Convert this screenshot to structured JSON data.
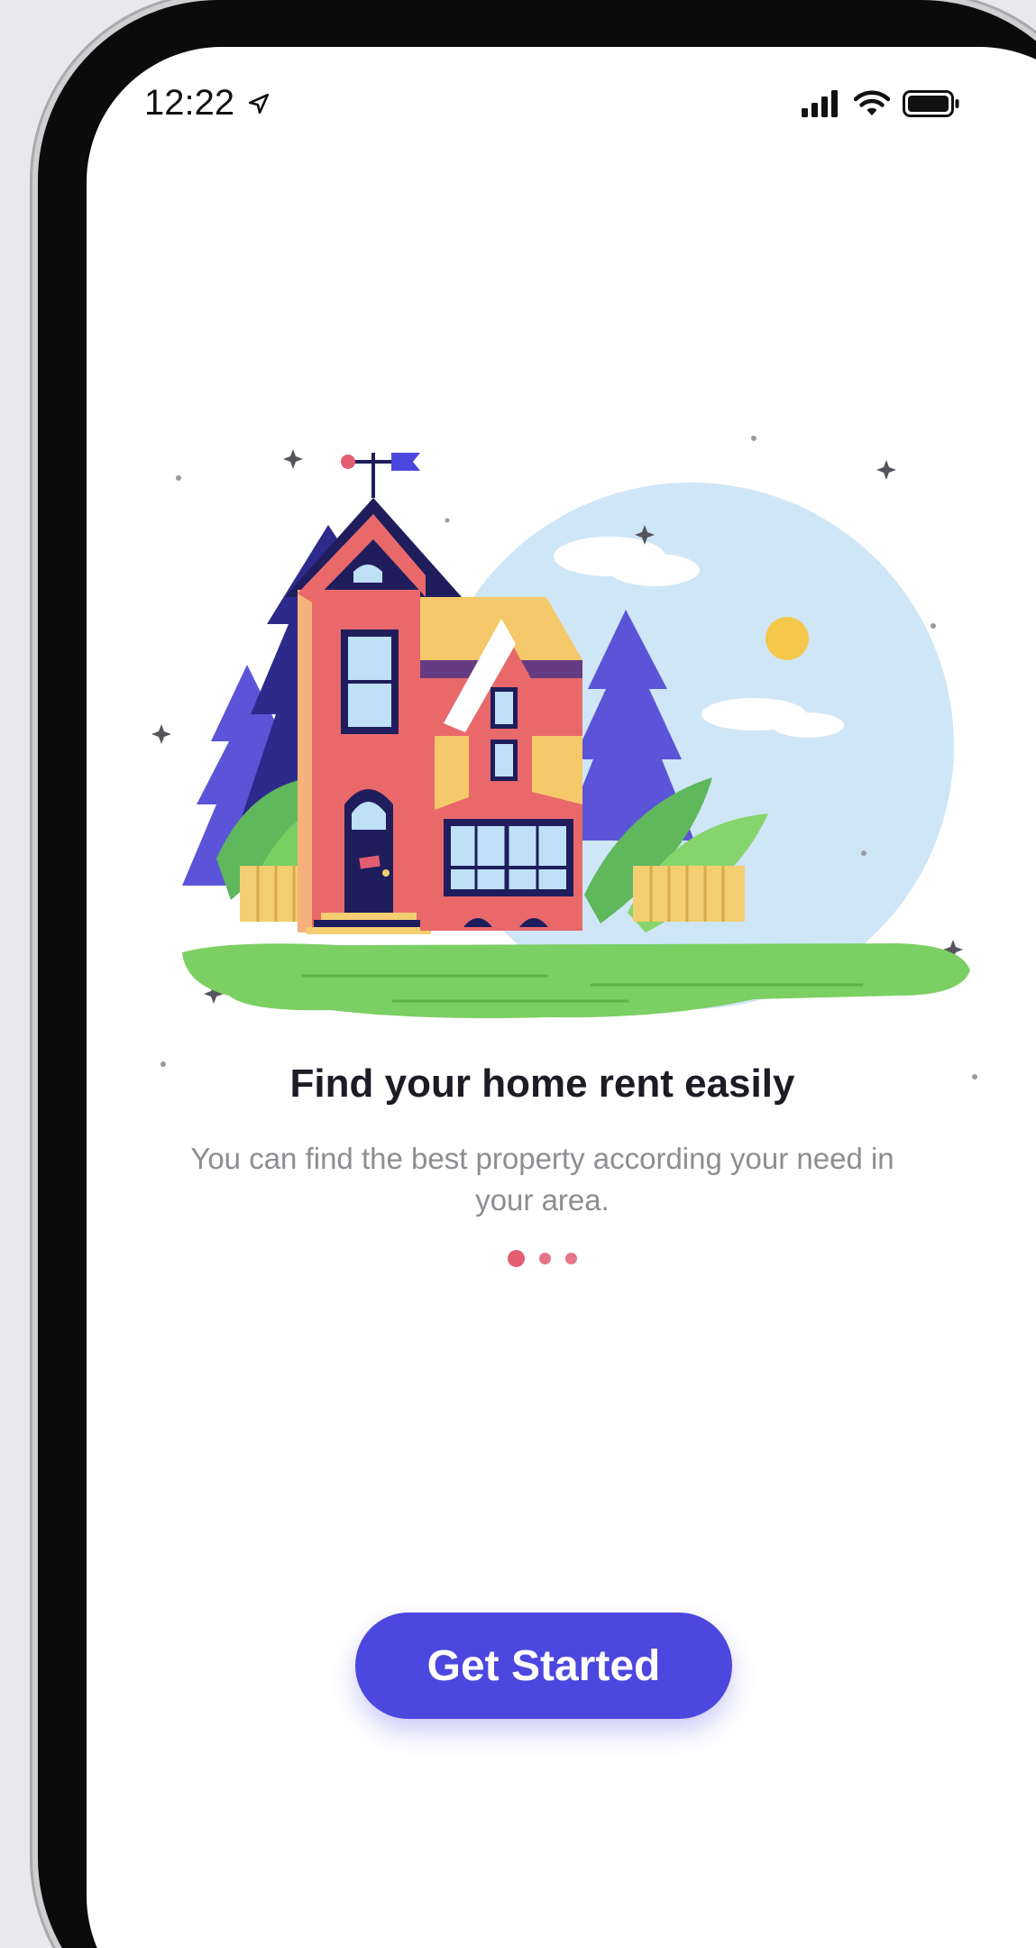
{
  "status_bar": {
    "time": "12:22",
    "location_icon": "location-arrow-icon",
    "signal_icon": "cellular-signal-icon",
    "wifi_icon": "wifi-icon",
    "battery_icon": "battery-icon"
  },
  "onboarding": {
    "illustration": "house-illustration",
    "title": "Find your home rent easily",
    "subtitle": "You can find the best property according your need in your area.",
    "page_count": 3,
    "current_page": 1
  },
  "actions": {
    "get_started_label": "Get Started"
  },
  "colors": {
    "accent": "#4c47de",
    "dot": "#e35d72",
    "title": "#1c1c24",
    "subtitle": "#8d8d92"
  }
}
